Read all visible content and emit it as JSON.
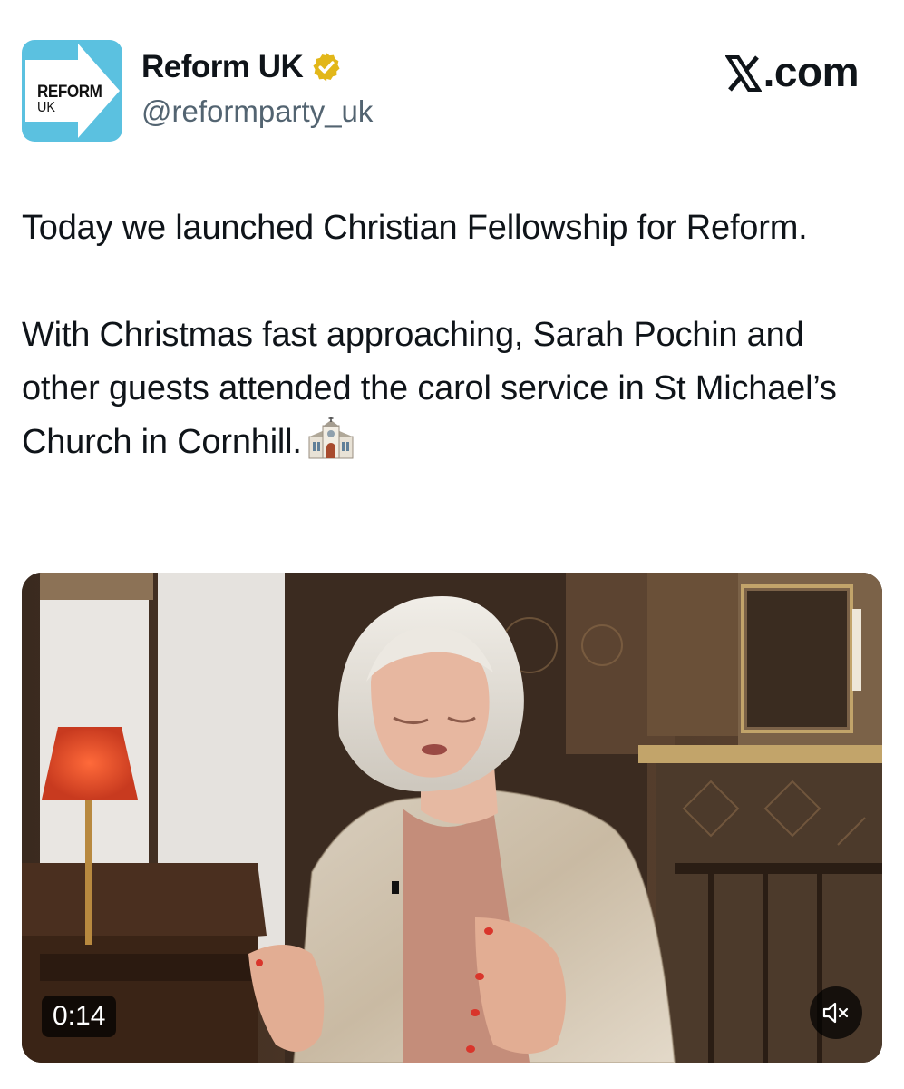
{
  "post": {
    "author": {
      "avatar_logo_line1": "REFORM",
      "avatar_logo_line2": "UK",
      "display_name": "Reform UK",
      "handle": "@reformparty_uk",
      "verified_badge_icon": "gold-verified-check-icon"
    },
    "site_mark": ".com",
    "site_mark_icon": "x-logo-icon",
    "text": {
      "paragraph1": "Today we launched Christian Fellowship for Reform.",
      "paragraph2": "With Christmas fast approaching, Sarah Pochin and other guests attended the carol service in St Michael’s Church in Cornhill.",
      "emoji_icon": "church-icon"
    },
    "video": {
      "duration": "0:14",
      "mute_icon": "speaker-muted-icon"
    }
  },
  "colors": {
    "brand_blue": "#5bc1e0",
    "text": "#0f1419",
    "secondary_text": "#536471",
    "verified_gold": "#e2b719"
  }
}
